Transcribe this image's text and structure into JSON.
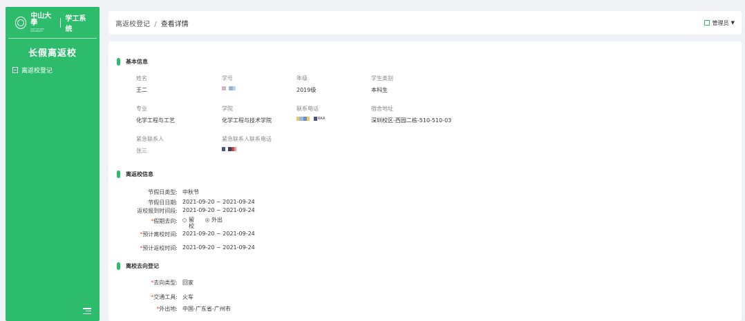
{
  "sidebar": {
    "logo_cn": "中山大學",
    "logo_en": "SUN YAT-SEN UNIVERSITY",
    "system_name": "学工系统",
    "module_title": "长假离返校",
    "menu": [
      {
        "label": "离返校登记",
        "icon": "document-icon"
      }
    ],
    "collapse_icon": "menu-collapse-icon"
  },
  "header": {
    "breadcrumb_parent": "离返校登记",
    "breadcrumb_sep": "/",
    "breadcrumb_current": "查看详情",
    "user_label": "管理员"
  },
  "basic": {
    "title": "基本信息",
    "name_label": "姓名",
    "name_value": "王二",
    "student_id_label": "学号",
    "grade_label": "年级",
    "grade_value": "2019级",
    "category_label": "学生类别",
    "category_value": "本科生",
    "major_label": "专业",
    "major_value": "化学工程与工艺",
    "college_label": "学院",
    "college_value": "化学工程与技术学院",
    "phone_label": "联系电话",
    "phone_suffix": "RAA",
    "dorm_label": "宿舍地址",
    "dorm_value": "深圳校区-西园二栋-510-510-03",
    "emergency_label": "紧急联系人",
    "emergency_value": "张三",
    "emergency_phone_label": "紧急联系人联系电话"
  },
  "leave": {
    "title": "离返校信息",
    "holiday_type_label": "节假日类型:",
    "holiday_type_value": "中秋节",
    "holiday_date_label": "节假日日期:",
    "holiday_date_value": "2021-09-20 ~ 2021-09-24",
    "return_window_label": "返校报到时间段:",
    "return_window_value": "2021-09-20 ~ 2021-09-24",
    "destination_label": "假期去向:",
    "option_stay": "留校",
    "option_out": "外出",
    "expected_leave_label": "预计离校时间:",
    "expected_leave_value": "2021-09-20 ~ 2021-09-24",
    "expected_return_label": "预计返校时间:",
    "expected_return_value": "2021-09-20 ~ 2021-09-24"
  },
  "destination": {
    "title": "离校去向登记",
    "type_label": "去向类型:",
    "type_value": "回家",
    "transport_label": "交通工具:",
    "transport_value": "火车",
    "place_label": "外出地:",
    "place_value": "中国-广东省-广州市"
  },
  "colors": {
    "brand": "#2dbb6c",
    "required": "#e74c3c"
  }
}
